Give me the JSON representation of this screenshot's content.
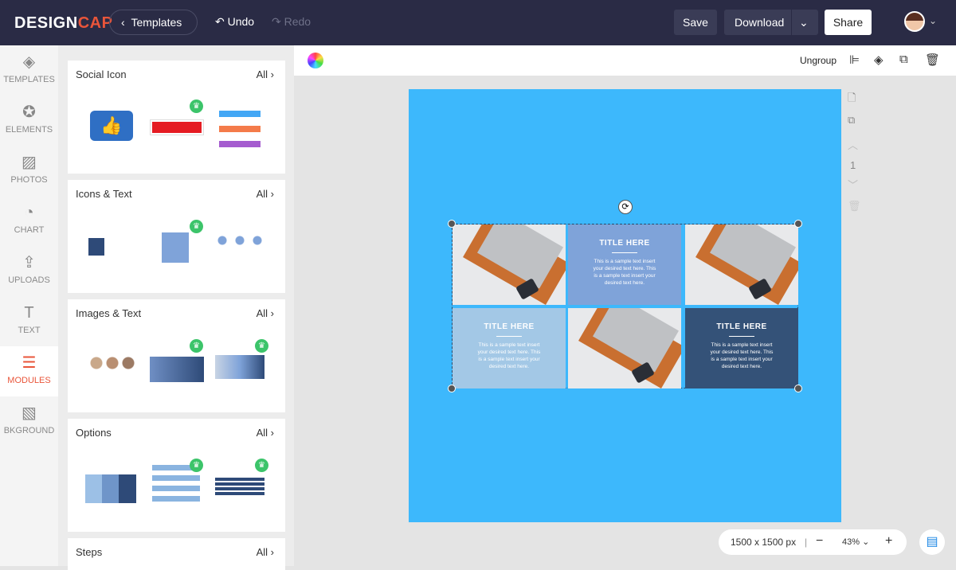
{
  "header": {
    "logo_a": "DESIGN",
    "logo_b": "CAP",
    "templates": "Templates",
    "undo": "Undo",
    "redo": "Redo",
    "save": "Save",
    "download": "Download",
    "share": "Share"
  },
  "sidebar": {
    "items": [
      {
        "label": "TEMPLATES",
        "icon": "layers-icon"
      },
      {
        "label": "ELEMENTS",
        "icon": "star-icon"
      },
      {
        "label": "PHOTOS",
        "icon": "image-icon"
      },
      {
        "label": "CHART",
        "icon": "pie-chart-icon"
      },
      {
        "label": "UPLOADS",
        "icon": "upload-icon"
      },
      {
        "label": "TEXT",
        "icon": "text-icon"
      },
      {
        "label": "MODULES",
        "icon": "list-icon"
      },
      {
        "label": "BKGROUND",
        "icon": "background-icon"
      }
    ]
  },
  "panel": {
    "all": "All",
    "sections": [
      {
        "title": "Social Icon"
      },
      {
        "title": "Icons & Text"
      },
      {
        "title": "Images & Text"
      },
      {
        "title": "Options"
      },
      {
        "title": "Steps"
      }
    ]
  },
  "toolbar": {
    "ungroup": "Ungroup"
  },
  "canvas": {
    "page_number": "1",
    "cells": {
      "title": "TITLE HERE",
      "text": "This is a sample text insert your desired text here. This is a sample text insert your desired text here."
    },
    "page_color": "#3db8fc"
  },
  "footer": {
    "size": "1500 x 1500 px",
    "zoom": "43%",
    "minus": "−",
    "plus": "+",
    "sep": "|"
  }
}
